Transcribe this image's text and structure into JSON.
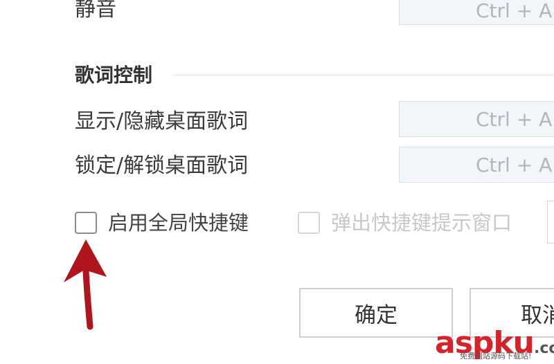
{
  "shortcuts": {
    "mute": {
      "label": "静音",
      "hotkey": "Ctrl + A"
    },
    "lyrics_section_title": "歌词控制",
    "toggle_desktop_lyrics": {
      "label": "显示/隐藏桌面歌词",
      "hotkey": "Ctrl + A"
    },
    "lock_desktop_lyrics": {
      "label": "锁定/解锁桌面歌词",
      "hotkey": "Ctrl + A"
    }
  },
  "options": {
    "enable_global_hotkeys": {
      "label": "启用全局快捷键",
      "checked": false,
      "enabled": true
    },
    "show_hotkey_popup": {
      "label": "弹出快捷键提示窗口",
      "checked": false,
      "enabled": false
    }
  },
  "buttons": {
    "ok": "确定",
    "cancel": "取消"
  },
  "annotation": {
    "arrow_color": "#b0141c"
  },
  "watermark": {
    "brand": "aspku",
    "brand_prefix": "asp",
    "brand_k": "k",
    "brand_u": "u",
    "domain_suffix": ".com",
    "tagline": "免费网站源码下载站!"
  }
}
